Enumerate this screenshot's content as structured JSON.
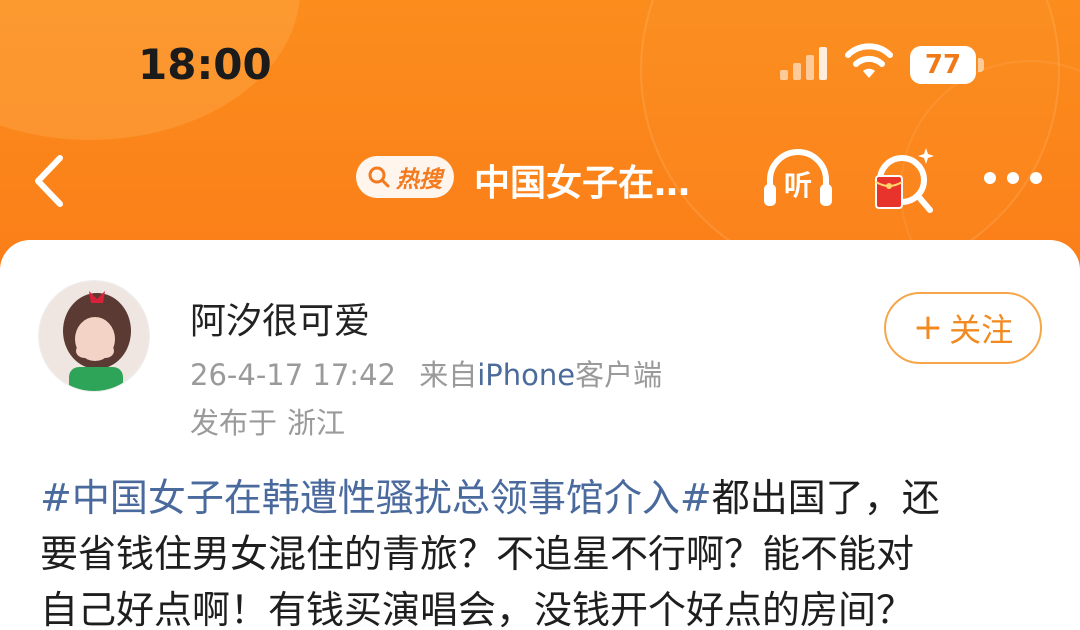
{
  "status_bar": {
    "time": "18:00",
    "battery_level": "77",
    "icons": [
      "signal-icon",
      "wifi-icon",
      "battery-icon"
    ]
  },
  "nav": {
    "hot_search_label": "热搜",
    "title": "中国女子在…",
    "listen_label": "听",
    "icons": [
      "back-icon",
      "search-icon",
      "listen-icon",
      "hongbao-search-icon",
      "more-icon"
    ]
  },
  "post": {
    "author": "阿汐很可爱",
    "time": "26-4-17 17:42",
    "source_prefix": "来自",
    "device": "iPhone",
    "client": "客户端",
    "location_prefix": "发布于",
    "location": "浙江",
    "follow_label": "关注",
    "topic": "#中国女子在韩遭性骚扰总领事馆介入#",
    "body_line_1": "都出国了，还",
    "body_line_2": "要省钱住男女混住的青旅？不追星不行啊？能不能对",
    "body_line_3": "自己好点啊！有钱买演唱会，没钱开个好点的房间？"
  },
  "colors": {
    "header_orange": "#fb7a17",
    "accent_orange": "#f28a21",
    "topic_blue": "#4a6a9e",
    "meta_gray": "#9a9a9a"
  }
}
